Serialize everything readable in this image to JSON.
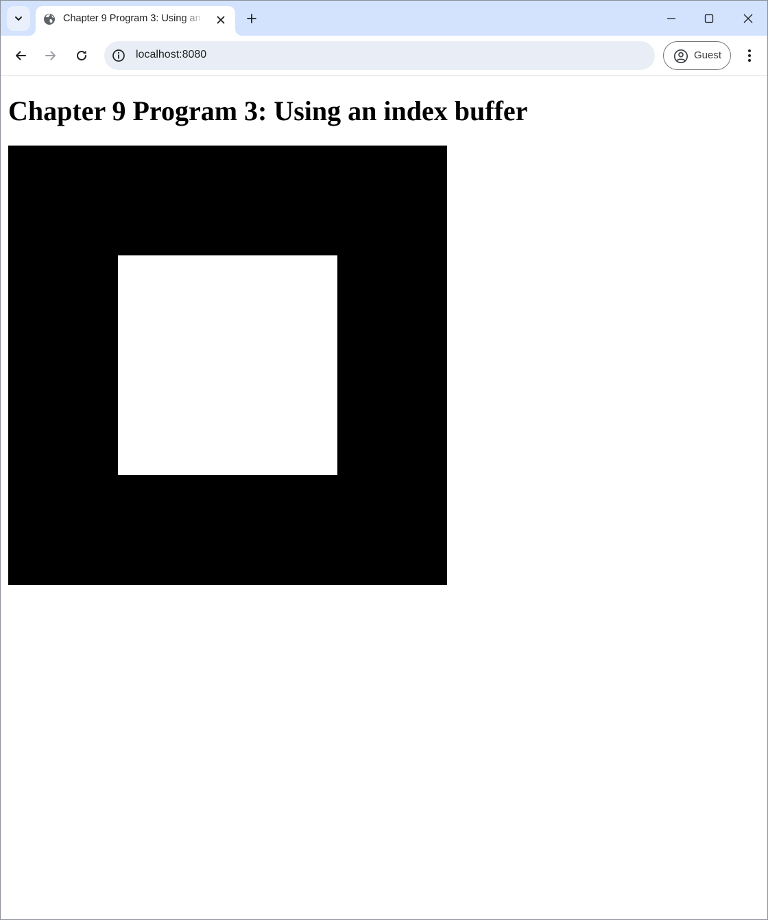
{
  "browser": {
    "tab": {
      "title": "Chapter 9 Program 3: Using an index buffer",
      "favicon": "globe-icon"
    },
    "address_bar": {
      "url": "localhost:8080",
      "site_info_icon": "info-icon"
    },
    "profile": {
      "label": "Guest",
      "icon": "account-circle-icon"
    },
    "controls": {
      "tab_search_icon": "chevron-down-icon",
      "close_tab_icon": "close-icon",
      "new_tab_icon": "plus-icon",
      "minimize_icon": "minimize-icon",
      "maximize_icon": "maximize-icon",
      "close_window_icon": "close-icon",
      "back_icon": "arrow-left-icon",
      "forward_icon": "arrow-right-icon",
      "reload_icon": "reload-icon",
      "menu_icon": "more-vert-icon"
    }
  },
  "page": {
    "heading": "Chapter 9 Program 3: Using an index buffer",
    "canvas": {
      "background_color": "#000000",
      "shape_color": "#ffffff"
    }
  },
  "colors": {
    "tabstrip": "#d3e3fd",
    "omnibox": "#e9eef6"
  }
}
